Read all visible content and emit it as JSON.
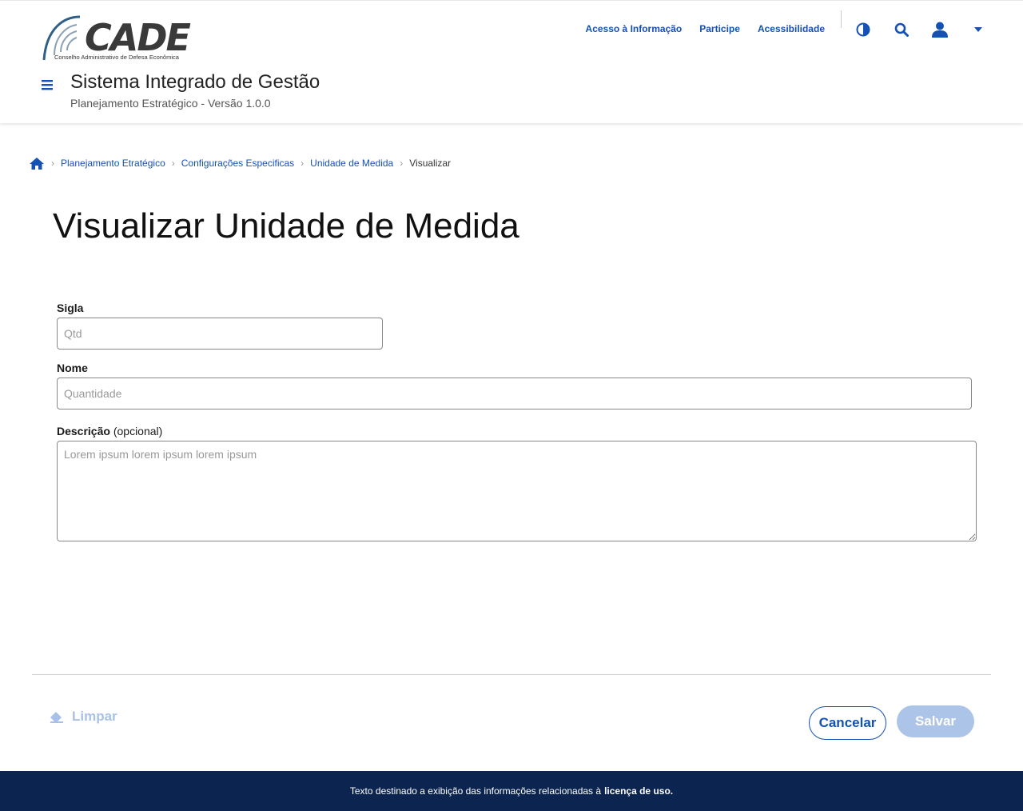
{
  "header": {
    "logo_text": "CADE",
    "logo_subtitle": "Conselho Administrativo de Defesa Econômica",
    "links": [
      "Acesso à Informação",
      "Participe",
      "Acessibilidade"
    ],
    "system_title": "Sistema Integrado de Gestão",
    "system_subtitle": "Planejamento Estratégico - Versão 1.0.0",
    "icons": [
      "contrast-icon",
      "search-icon",
      "user-icon",
      "caret-down-icon",
      "menu-icon"
    ],
    "accent_color": "#1351b4"
  },
  "breadcrumb": {
    "items": [
      "Planejamento Etratégico",
      "Configurações Especificas",
      "Unidade de Medida"
    ],
    "current": "Visualizar"
  },
  "page": {
    "title": "Visualizar Unidade de Medida"
  },
  "form": {
    "sigla": {
      "label": "Sigla",
      "placeholder": "Qtd"
    },
    "nome": {
      "label": "Nome",
      "placeholder": "Quantidade"
    },
    "descricao": {
      "label": "Descrição",
      "optional": "(opcional)",
      "placeholder": "Lorem ipsum lorem ipsum lorem ipsum"
    }
  },
  "actions": {
    "clear_label": "Limpar",
    "cancel_label": "Cancelar",
    "save_label": "Salvar"
  },
  "footer": {
    "text": "Texto destinado a exibição das informações relacionadas à",
    "link": "licença de uso."
  }
}
